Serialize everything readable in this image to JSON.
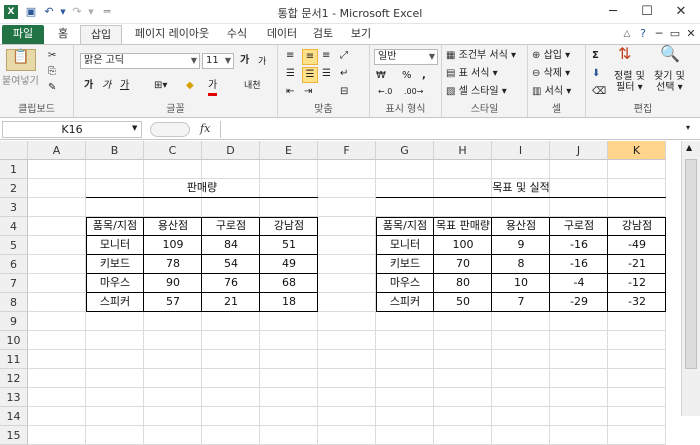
{
  "window": {
    "title": "통합 문서1  -  Microsoft Excel",
    "minimize": "─",
    "maximize": "☐",
    "close": "✕",
    "help": "?",
    "ribbon_min": "△",
    "restore": "▭",
    "close_doc": "✕"
  },
  "tabs": [
    "파일",
    "홈",
    "삽입",
    "페이지 레이아웃",
    "수식",
    "데이터",
    "검토",
    "보기"
  ],
  "ribbon": {
    "clipboard": {
      "paste_label": "붙여넣기",
      "group_label": "클립보드"
    },
    "font": {
      "name": "맑은 고딕",
      "size": "11",
      "bold": "가",
      "italic": "가",
      "underline": "가",
      "grow": "가",
      "shrink": "가",
      "fill_icon": "◆",
      "font_color": "가",
      "phonetic": "내천",
      "group_label": "글꼴"
    },
    "align": {
      "group_label": "맞춤"
    },
    "number": {
      "format": "일반",
      "percent": "%",
      "comma": ",",
      "group_label": "표시 형식",
      "currency": "₩"
    },
    "styles": {
      "cond": "조건부 서식",
      "table": "표 서식",
      "cell": "셀 스타일",
      "group_label": "스타일"
    },
    "cells": {
      "insert": "삽입",
      "delete": "삭제",
      "format": "서식",
      "group_label": "셀"
    },
    "editing": {
      "sort1": "정렬 및",
      "sort2": "필터",
      "find1": "찾기 및",
      "find2": "선택",
      "sigma": "Σ",
      "group_label": "편집"
    }
  },
  "formula": {
    "namebox": "K16",
    "fx": "fx",
    "content": ""
  },
  "columns": [
    "A",
    "B",
    "C",
    "D",
    "E",
    "F",
    "G",
    "H",
    "I",
    "J",
    "K"
  ],
  "rows": [
    "1",
    "2",
    "3",
    "4",
    "5",
    "6",
    "7",
    "8",
    "9",
    "10",
    "11",
    "12",
    "13",
    "14",
    "15"
  ],
  "selected_column": "K",
  "table1": {
    "title": "판매량",
    "headers": [
      "품목/지점",
      "용산점",
      "구로점",
      "강남점"
    ],
    "rows": [
      [
        "모니터",
        "109",
        "84",
        "51"
      ],
      [
        "키보드",
        "78",
        "54",
        "49"
      ],
      [
        "마우스",
        "90",
        "76",
        "68"
      ],
      [
        "스피커",
        "57",
        "21",
        "18"
      ]
    ]
  },
  "table2": {
    "title": "목표 및 실적",
    "headers": [
      "품목/지점",
      "목표 판매량",
      "용산점",
      "구로점",
      "강남점"
    ],
    "rows": [
      [
        "모니터",
        "100",
        "9",
        "-16",
        "-49"
      ],
      [
        "키보드",
        "70",
        "8",
        "-16",
        "-21"
      ],
      [
        "마우스",
        "80",
        "10",
        "-4",
        "-12"
      ],
      [
        "스피커",
        "50",
        "7",
        "-29",
        "-32"
      ]
    ]
  },
  "colors": {
    "accent": "#217346",
    "selected_header": "#ffd58e"
  }
}
